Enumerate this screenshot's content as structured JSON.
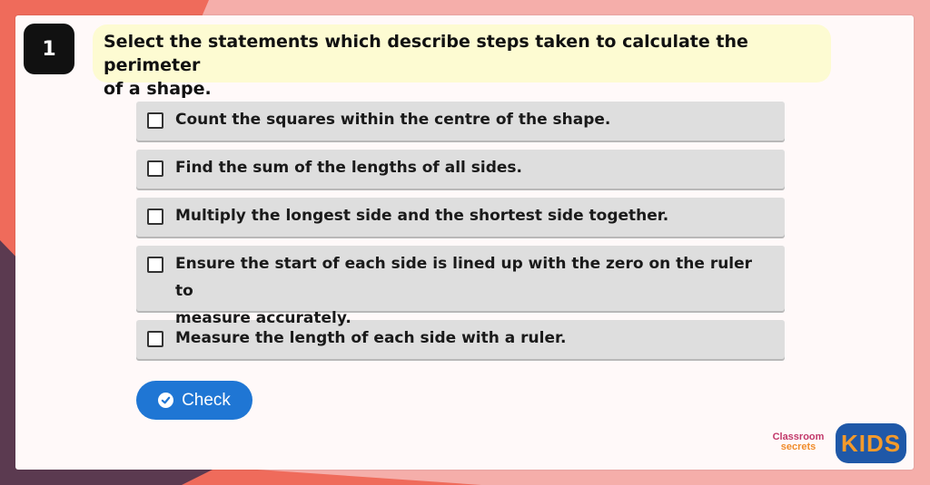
{
  "question": {
    "number": "1",
    "prompt_line1": "Select the statements which describe steps taken to calculate the perimeter",
    "prompt_line2": "of a shape."
  },
  "options": [
    {
      "label": "Count the squares within the centre of the shape.",
      "checked": false
    },
    {
      "label": "Find the sum of the lengths of all sides.",
      "checked": false
    },
    {
      "label": "Multiply the longest side and the shortest side together.",
      "checked": false
    },
    {
      "label_line1": "Ensure the start of each side is lined up with the zero on the ruler to",
      "label_line2": "measure accurately.",
      "checked": false
    },
    {
      "label": "Measure the length of each side with a ruler.",
      "checked": false
    }
  ],
  "check_button": {
    "label": "Check",
    "icon": "check-circle-icon"
  },
  "branding": {
    "classroom": "Classroom",
    "secrets": "secrets",
    "kids": "KIDS"
  },
  "colors": {
    "accent": "#1f76d4",
    "prompt_bg": "#fdfbd2",
    "option_bg": "#dedede",
    "bg_coral": "#ef6b5b",
    "bg_pink": "#f5aeaa",
    "bg_purple": "#5b3a50"
  }
}
